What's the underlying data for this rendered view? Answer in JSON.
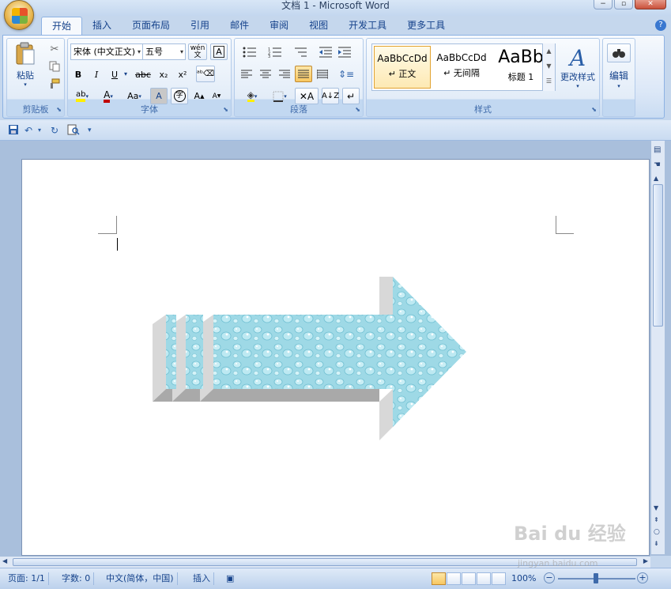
{
  "window": {
    "title": "文档 1 - Microsoft Word",
    "minimize": "−",
    "restore": "▫",
    "close": "✕"
  },
  "tabs": [
    "开始",
    "插入",
    "页面布局",
    "引用",
    "邮件",
    "审阅",
    "视图",
    "开发工具",
    "更多工具"
  ],
  "active_tab": "开始",
  "ribbon": {
    "clipboard": {
      "label": "剪贴板",
      "paste": "粘贴"
    },
    "font": {
      "label": "字体",
      "font_name": "宋体 (中文正文)",
      "font_size": "五号",
      "bold": "B",
      "italic": "I",
      "underline": "U",
      "strike": "abc",
      "subscript": "x₂",
      "superscript": "x²",
      "grow": "A",
      "shrink": "A",
      "case": "Aa",
      "color_a": "A",
      "shade_a": "A",
      "enclose": "字",
      "wen": "wén",
      "highlight": "ab"
    },
    "paragraph": {
      "label": "段落"
    },
    "styles": {
      "label": "样式",
      "items": [
        {
          "sample": "AaBbCcDd",
          "name": "↵ 正文"
        },
        {
          "sample": "AaBbCcDd",
          "name": "↵ 无间隔"
        },
        {
          "sample": "AaBb",
          "name": "标题 1"
        }
      ],
      "change_styles": "更改样式"
    },
    "editing": {
      "label": "编辑"
    }
  },
  "status": {
    "page": "页面: 1/1",
    "words": "字数: 0",
    "language": "中文(简体，中国)",
    "mode": "插入",
    "zoom": "100%"
  },
  "colors": {
    "accent": "#15428b",
    "arrow_shadow": "#a9a9a9",
    "arrow_side": "#d8d8d8",
    "arrow_fill": "#9ed9e6"
  },
  "icons": [
    "save-icon",
    "undo-icon",
    "redo-icon",
    "print-preview-icon",
    "clipboard-icon",
    "scissors-icon",
    "copy-icon",
    "format-painter-icon",
    "binoculars-icon"
  ]
}
